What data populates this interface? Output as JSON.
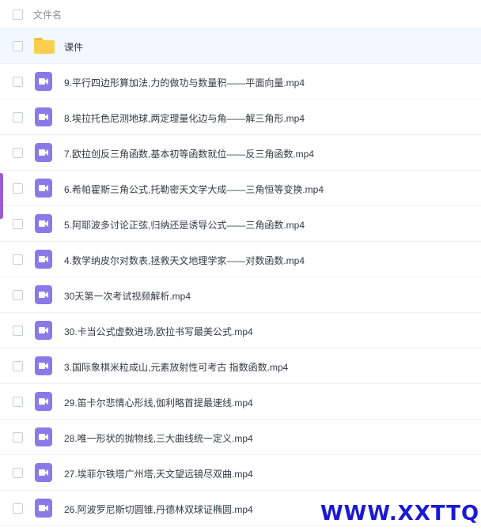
{
  "header": {
    "column_label": "文件名"
  },
  "colors": {
    "folder": "#fbcf4d",
    "video": "#8c79e8",
    "selected_row": "#f1f8ff",
    "watermark": "#1a1ad6",
    "side_accent": "#9a5bd6"
  },
  "files": [
    {
      "name": "课件",
      "icon": "folder-icon",
      "selected": true
    },
    {
      "name": "9.平行四边形算加法,力的做功与数量积——平面向量.mp4",
      "icon": "video-file-icon"
    },
    {
      "name": "8.埃拉托色尼测地球,两定理量化边与角——解三角形.mp4",
      "icon": "video-file-icon"
    },
    {
      "name": "7.欧拉创反三角函数,基本初等函数就位——反三角函数.mp4",
      "icon": "video-file-icon"
    },
    {
      "name": "6.希帕霍斯三角公式,托勒密天文学大成——三角恒等变换.mp4",
      "icon": "video-file-icon"
    },
    {
      "name": "5.阿耶波多讨论正弦,归纳还是诱导公式——三角函数.mp4",
      "icon": "video-file-icon"
    },
    {
      "name": "4.数学纳皮尔对数表,拯救天文地理学家——对数函数.mp4",
      "icon": "video-file-icon"
    },
    {
      "name": "30天第一次考试视频解析.mp4",
      "icon": "video-file-icon"
    },
    {
      "name": "30.卡当公式虚数进场,欧拉书写最美公式.mp4",
      "icon": "video-file-icon"
    },
    {
      "name": "3.国际象棋米粒成山,元素放射性可考古 指数函数.mp4",
      "icon": "video-file-icon"
    },
    {
      "name": "29.笛卡尔悲情心形线,伽利略首提最速线.mp4",
      "icon": "video-file-icon"
    },
    {
      "name": "28.唯一形状的抛物线,三大曲线统一定义.mp4",
      "icon": "video-file-icon"
    },
    {
      "name": "27.埃菲尔铁塔广州塔,天文望远镜尽双曲.mp4",
      "icon": "video-file-icon"
    },
    {
      "name": "26.阿波罗尼斯切圆锥,丹德林双球证椭圆.mp4",
      "icon": "video-file-icon"
    }
  ],
  "watermark": "WWW.XXTTQ.COM"
}
